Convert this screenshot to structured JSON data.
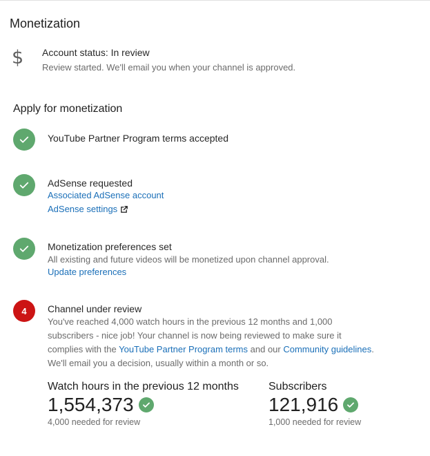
{
  "monetization": {
    "title": "Monetization",
    "status_icon": "dollar-icon",
    "status_title": "Account status: In review",
    "status_subtitle": "Review started. We'll email you when your channel is approved."
  },
  "apply": {
    "title": "Apply for monetization",
    "steps": [
      {
        "state": "done",
        "title": "YouTube Partner Program terms accepted"
      },
      {
        "state": "done",
        "title": "AdSense requested",
        "link_1": "Associated AdSense account",
        "link_2": "AdSense settings",
        "link_2_icon": "external-link-icon"
      },
      {
        "state": "done",
        "title": "Monetization preferences set",
        "text": "All existing and future videos will be monetized upon channel approval.",
        "link_1": "Update preferences"
      },
      {
        "state": "pending",
        "number": "4",
        "title": "Channel under review",
        "text_1": "You've reached 4,000 watch hours in the previous 12 months and 1,000",
        "text_2": "subscribers - nice job! Your channel is now being reviewed to make sure it",
        "text_3_prefix": "complies with the",
        "text_3_link_1": "YouTube Partner Program terms",
        "text_3_mid": "and our",
        "text_3_link_2": "Community guidelines",
        "text_3_suffix": ".",
        "text_4": "We'll email you a decision, usually within a month or so."
      }
    ]
  },
  "stats": {
    "watch_hours": {
      "label": "Watch hours in the previous 12 months",
      "value": "1,554,373",
      "note": "4,000 needed for review"
    },
    "subscribers": {
      "label": "Subscribers",
      "value": "121,916",
      "note": "1,000 needed for review"
    }
  },
  "colors": {
    "check_green": "#5fa86e",
    "pending_red": "#cc1414",
    "link_blue": "#1a6fb8"
  }
}
